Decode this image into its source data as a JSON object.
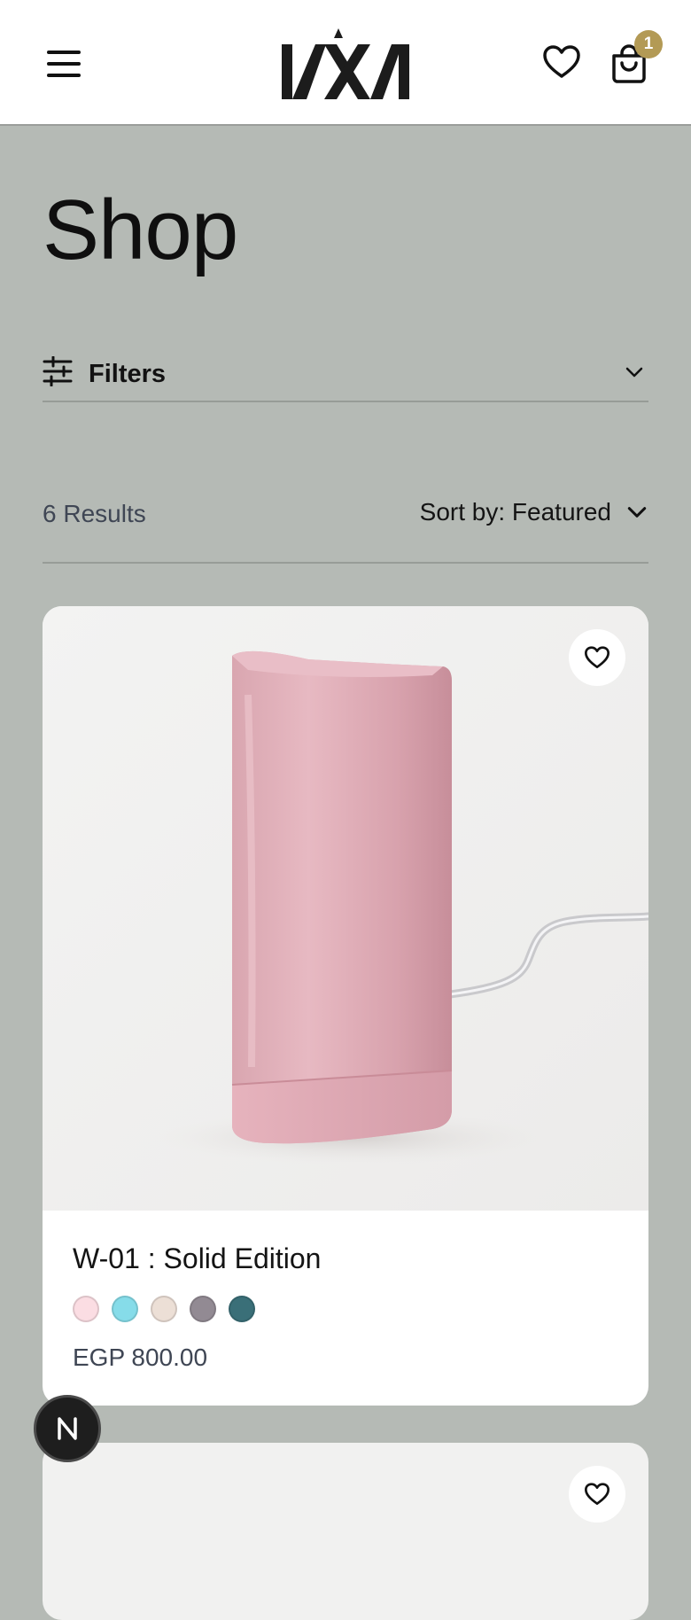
{
  "header": {
    "menu_icon": "hamburger-menu-icon",
    "logo_icon": "brand-logo",
    "wishlist_icon": "heart-icon",
    "cart_icon": "shopping-bag-icon",
    "cart_count": "1",
    "badge_color": "#b39a55"
  },
  "page": {
    "title": "Shop"
  },
  "filters": {
    "label": "Filters",
    "icon": "sliders-icon",
    "toggle_icon": "chevron-down-icon"
  },
  "results": {
    "count_text": "6 Results",
    "sort_label": "Sort by: Featured",
    "sort_icon": "chevron-down-icon"
  },
  "products": [
    {
      "name": "W-01 : Solid Edition",
      "price": "EGP 800.00",
      "wishlist_icon": "heart-icon",
      "colors": [
        "#fbdde3",
        "#86dce9",
        "#ecdfd6",
        "#928a93",
        "#3a6f78"
      ],
      "image": "pink-water-filter-product-photo"
    },
    {
      "wishlist_icon": "heart-icon"
    }
  ],
  "floating_button": {
    "icon": "n-logo-icon"
  }
}
